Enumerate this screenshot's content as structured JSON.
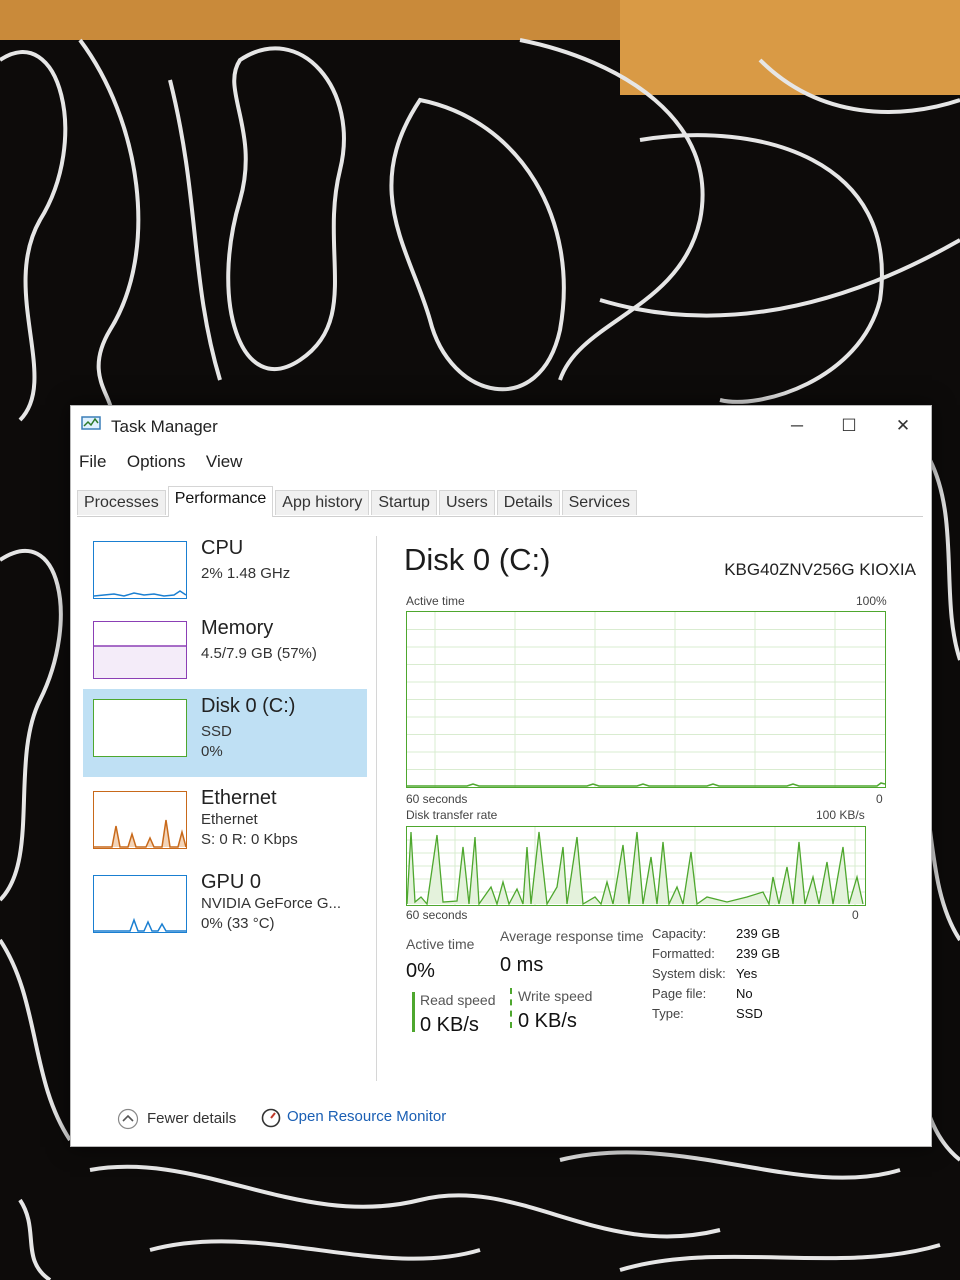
{
  "window": {
    "title": "Task Manager",
    "controls": {
      "minimize": "─",
      "maximize": "☐",
      "close": "✕"
    }
  },
  "menu": [
    "File",
    "Options",
    "View"
  ],
  "tabs": [
    "Processes",
    "Performance",
    "App history",
    "Startup",
    "Users",
    "Details",
    "Services"
  ],
  "active_tab": "Performance",
  "sidebar": {
    "items": [
      {
        "title": "CPU",
        "line1": "2% 1.48 GHz",
        "line2": "",
        "color": "#1a7fd1",
        "selected": false
      },
      {
        "title": "Memory",
        "line1": "4.5/7.9 GB (57%)",
        "line2": "",
        "color": "#8b3fb5",
        "selected": false
      },
      {
        "title": "Disk 0 (C:)",
        "line1": "SSD",
        "line2": "0%",
        "color": "#4ea72e",
        "selected": true
      },
      {
        "title": "Ethernet",
        "line1": "Ethernet",
        "line2": "S: 0 R: 0 Kbps",
        "color": "#c8691a",
        "selected": false
      },
      {
        "title": "GPU 0",
        "line1": "NVIDIA GeForce G...",
        "line2": "0% (33 °C)",
        "color": "#1a7fd1",
        "selected": false
      }
    ]
  },
  "main": {
    "title": "Disk 0 (C:)",
    "model": "KBG40ZNV256G KIOXIA",
    "graph1": {
      "label": "Active time",
      "max": "100%",
      "time": "60 seconds",
      "min": "0"
    },
    "graph2": {
      "label": "Disk transfer rate",
      "max": "100 KB/s",
      "time": "60 seconds",
      "min": "0"
    },
    "stats": {
      "active_time_label": "Active time",
      "active_time": "0%",
      "avg_response_label": "Average response time",
      "avg_response": "0 ms",
      "read_label": "Read speed",
      "read": "0 KB/s",
      "write_label": "Write speed",
      "write": "0 KB/s"
    },
    "props": [
      {
        "label": "Capacity:",
        "value": "239 GB"
      },
      {
        "label": "Formatted:",
        "value": "239 GB"
      },
      {
        "label": "System disk:",
        "value": "Yes"
      },
      {
        "label": "Page file:",
        "value": "No"
      },
      {
        "label": "Type:",
        "value": "SSD"
      }
    ]
  },
  "footer": {
    "fewer_details": "Fewer details",
    "resource_monitor": "Open Resource Monitor"
  },
  "colors": {
    "disk": "#4ea72e",
    "selected_bg": "#bfe0f4",
    "link": "#1a5fb4"
  }
}
